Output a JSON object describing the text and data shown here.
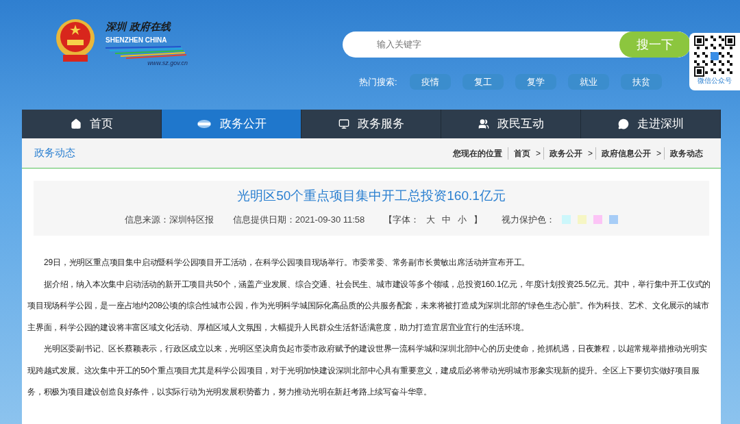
{
  "logo": {
    "title": "深圳 政府在线",
    "subtitle": "SHENZHEN CHINA",
    "url": "www.sz.gov.cn"
  },
  "search": {
    "placeholder": "输入关键字",
    "button": "搜一下"
  },
  "hot_search": {
    "label": "热门搜索:",
    "tags": [
      "疫情",
      "复工",
      "复学",
      "就业",
      "扶贫"
    ]
  },
  "qr": {
    "caption": "微信公众号"
  },
  "nav": [
    {
      "label": "首页",
      "kind": "home",
      "selected": false
    },
    {
      "label": "政务公开",
      "kind": "news",
      "selected": true
    },
    {
      "label": "政务服务",
      "kind": "monitor",
      "selected": false
    },
    {
      "label": "政民互动",
      "kind": "users",
      "selected": false
    },
    {
      "label": "走进深圳",
      "kind": "chat",
      "selected": false
    }
  ],
  "section_title": "政务动态",
  "breadcrumb": {
    "label": "您现在的位置",
    "items": [
      "首页",
      "政务公开",
      "政府信息公开",
      "政务动态"
    ],
    "separator": ">"
  },
  "article": {
    "title": "光明区50个重点项目集中开工总投资160.1亿元",
    "source": "信息来源：深圳特区报",
    "date": "信息提供日期：2021-09-30 11:58",
    "font_size": {
      "open": "【字体：",
      "sizes": [
        "大",
        "中",
        "小"
      ],
      "close": "】"
    },
    "eye_care": {
      "label": "视力保护色：",
      "colors": [
        {
          "color": "#ccf7fb"
        },
        {
          "color": "#f6f6c4"
        },
        {
          "color": "#fcc4f6"
        },
        {
          "color": "#a7cdf7"
        }
      ]
    },
    "paragraphs": [
      "29日，光明区重点项目集中启动暨科学公园项目开工活动，在科学公园项目现场举行。市委常委、常务副市长黄敏出席活动并宣布开工。",
      "据介绍，纳入本次集中启动活动的新开工项目共50个，涵盖产业发展、综合交通、社会民生、城市建设等多个领域，总投资160.1亿元，年度计划投资25.5亿元。其中，举行集中开工仪式的项目现场科学公园，是一座占地约208公顷的综合性城市公园，作为光明科学城国际化高品质的公共服务配套，未来将被打造成为深圳北部的“绿色生态心脏”。作为科技、艺术、文化展示的城市主界面，科学公园的建设将丰富区域文化活动、厚植区域人文氛围，大幅提升人民群众生活舒适满意度，助力打造宜居宜业宜行的生活环境。",
      "光明区委副书记、区长蔡颖表示，行政区成立以来，光明区坚决肩负起市委市政府赋予的建设世界一流科学城和深圳北部中心的历史使命，抢抓机遇，日夜兼程，以超常规举措推动光明实现跨越式发展。这次集中开工的50个重点项目尤其是科学公园项目，对于光明加快建设深圳北部中心具有重要意义，建成后必将带动光明城市形象实现新的提升。全区上下要切实做好项目服务，积极为项目建设创造良好条件，以实际行动为光明发展积势蓄力，努力推动光明在新赶考路上续写奋斗华章。"
    ]
  }
}
